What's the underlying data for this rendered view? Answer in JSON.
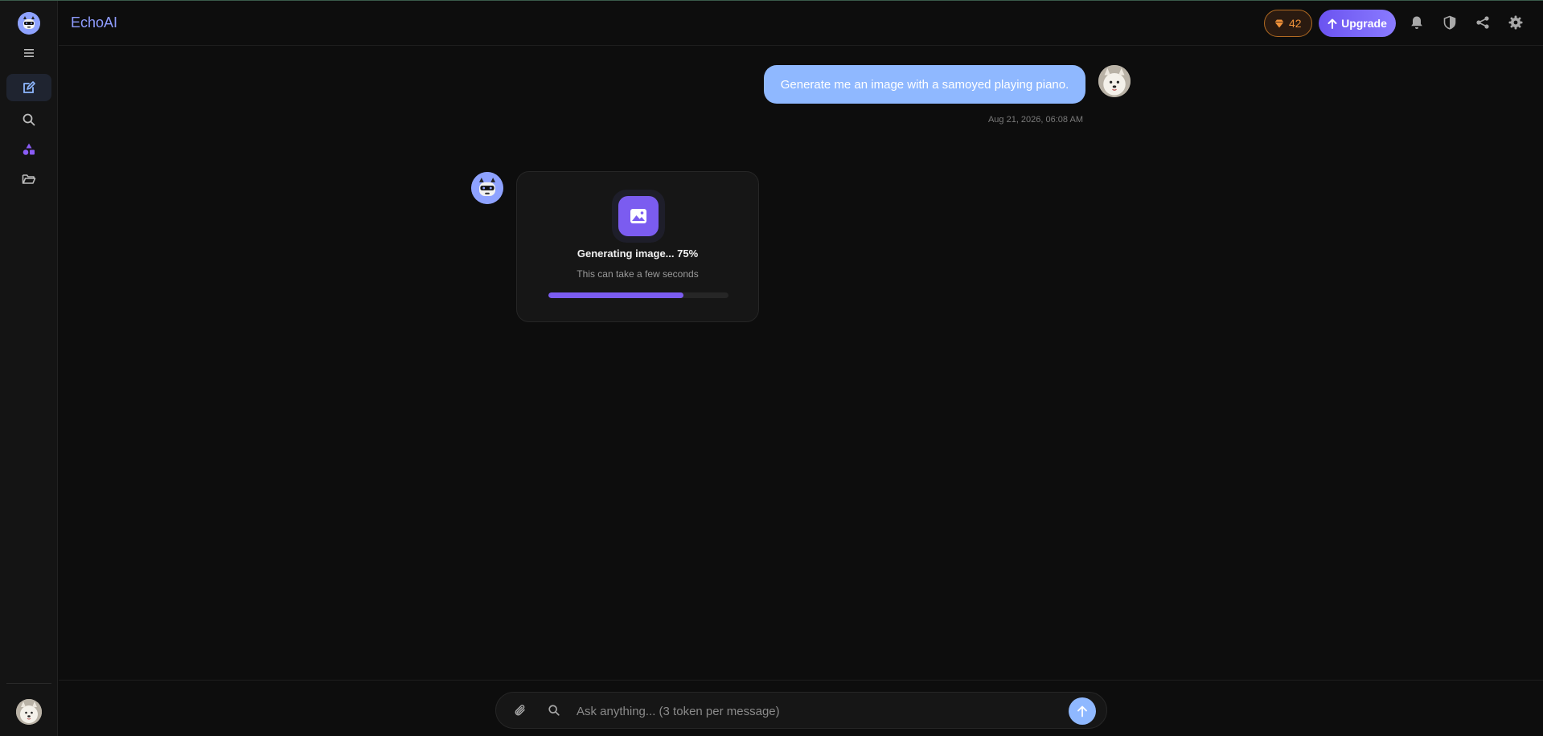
{
  "app": {
    "brand": "EchoAI"
  },
  "sidebar": {
    "items": [
      {
        "name": "new-chat",
        "icon": "edit-icon",
        "active": true
      },
      {
        "name": "search",
        "icon": "search-icon",
        "active": false
      },
      {
        "name": "apps",
        "icon": "shapes-icon",
        "active": false
      },
      {
        "name": "files",
        "icon": "folder-open-icon",
        "active": false
      }
    ]
  },
  "header": {
    "gems_count": "42",
    "upgrade_label": "Upgrade",
    "icons": [
      "bell-icon",
      "shield-icon",
      "share-icon",
      "gear-icon"
    ]
  },
  "chat": {
    "user_message": "Generate me an image with a samoyed playing piano.",
    "timestamp": "Aug 21, 2026, 06:08 AM",
    "generation": {
      "title": "Generating image... 75%",
      "subtitle": "This can take a few seconds",
      "progress": 0.75
    }
  },
  "input": {
    "placeholder": "Ask anything... (3 token per message)",
    "value": ""
  },
  "colors": {
    "accent": "#7b5cf0",
    "brand": "#8f9cff",
    "user_bubble": "#8fb8ff",
    "gem": "#f0923a"
  }
}
